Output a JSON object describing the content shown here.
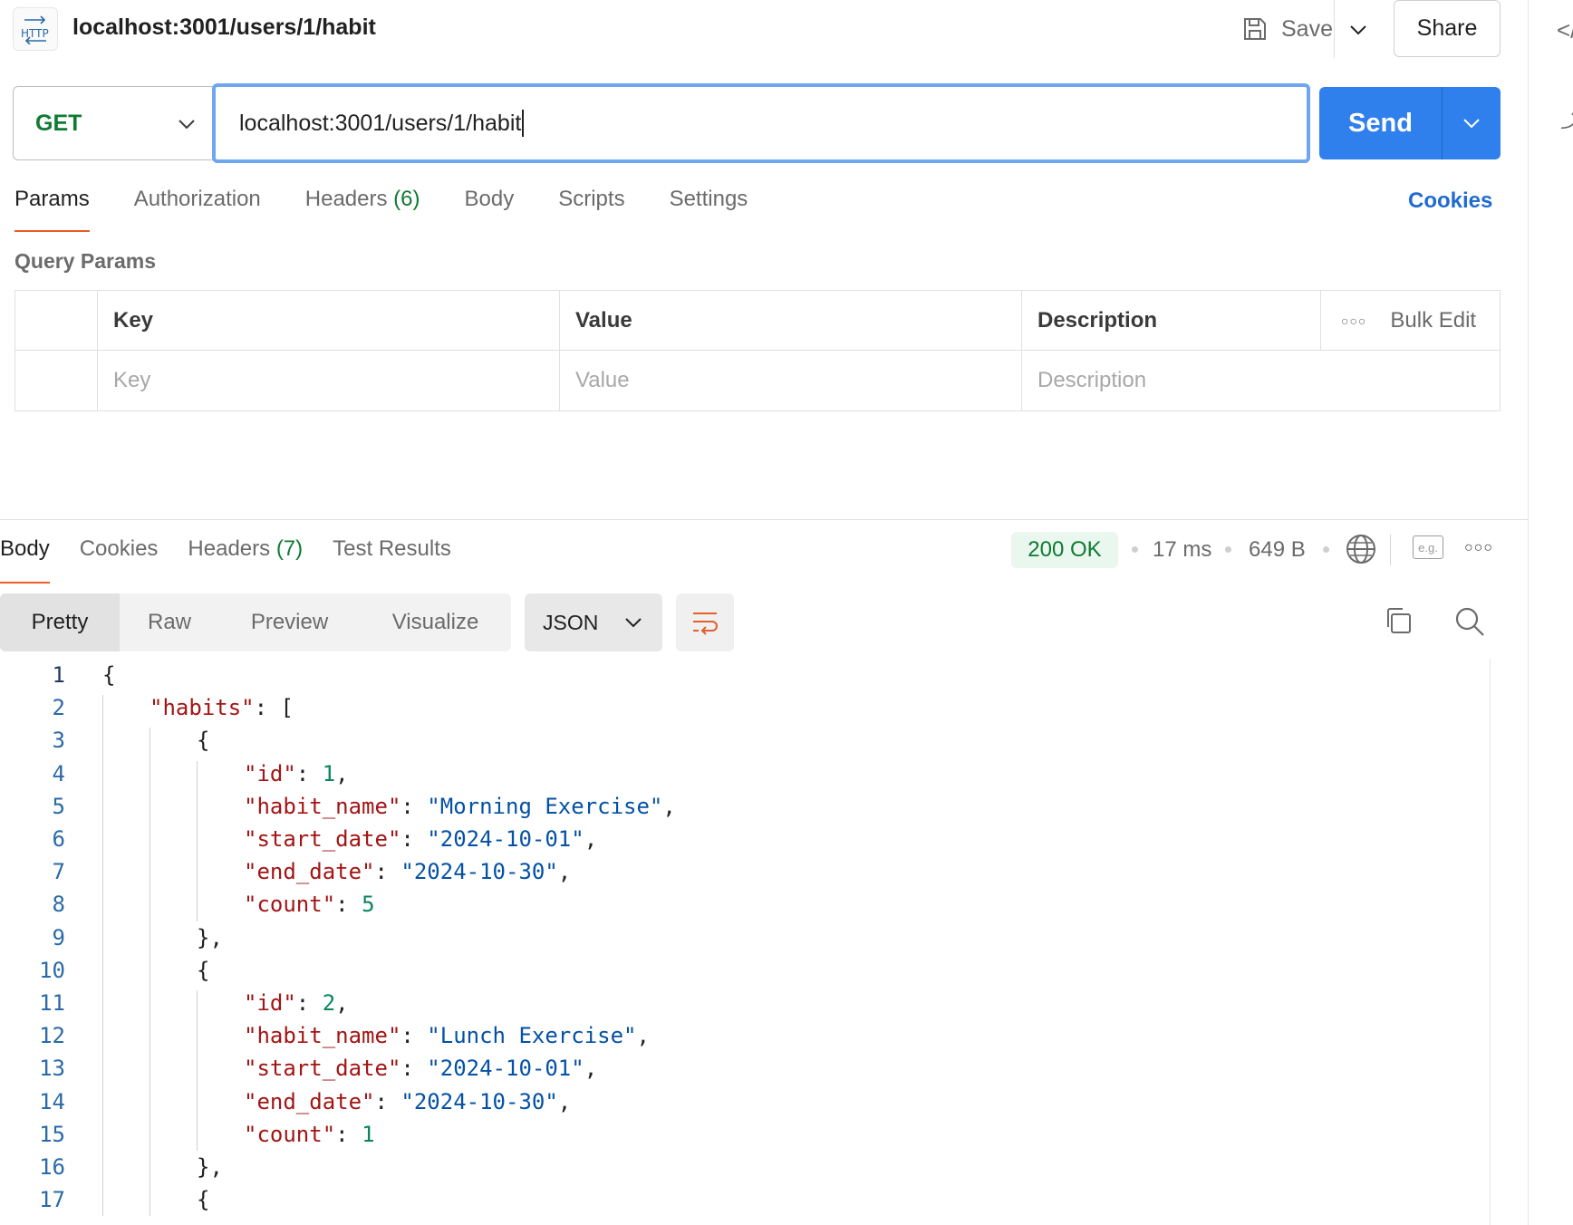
{
  "header": {
    "badge_label": "HTTP",
    "title": "localhost:3001/users/1/habit",
    "save_label": "Save",
    "share_label": "Share"
  },
  "request": {
    "method": "GET",
    "url": "localhost:3001/users/1/habit",
    "send_label": "Send"
  },
  "request_tabs": {
    "params": "Params",
    "authorization": "Authorization",
    "headers": "Headers",
    "headers_count": "(6)",
    "body": "Body",
    "scripts": "Scripts",
    "settings": "Settings",
    "cookies": "Cookies"
  },
  "query_params": {
    "title": "Query Params",
    "columns": {
      "key": "Key",
      "value": "Value",
      "description": "Description",
      "bulk_edit": "Bulk Edit"
    },
    "placeholders": {
      "key": "Key",
      "value": "Value",
      "description": "Description"
    }
  },
  "response_tabs": {
    "body": "Body",
    "cookies": "Cookies",
    "headers": "Headers",
    "headers_count": "(7)",
    "test_results": "Test Results"
  },
  "response_meta": {
    "status": "200 OK",
    "time": "17 ms",
    "size": "649 B",
    "example_label": "e.g."
  },
  "response_toolbar": {
    "views": [
      "Pretty",
      "Raw",
      "Preview",
      "Visualize"
    ],
    "active_view": "Pretty",
    "format": "JSON"
  },
  "code_lines": [
    {
      "n": "1",
      "indent": 0,
      "parts": [
        [
          "p",
          "{"
        ]
      ]
    },
    {
      "n": "2",
      "indent": 1,
      "parts": [
        [
          "k",
          "\"habits\""
        ],
        [
          "p",
          ": ["
        ]
      ]
    },
    {
      "n": "3",
      "indent": 2,
      "parts": [
        [
          "p",
          "{"
        ]
      ]
    },
    {
      "n": "4",
      "indent": 3,
      "parts": [
        [
          "k",
          "\"id\""
        ],
        [
          "p",
          ": "
        ],
        [
          "n",
          "1"
        ],
        [
          "p",
          ","
        ]
      ]
    },
    {
      "n": "5",
      "indent": 3,
      "parts": [
        [
          "k",
          "\"habit_name\""
        ],
        [
          "p",
          ": "
        ],
        [
          "s",
          "\"Morning Exercise\""
        ],
        [
          "p",
          ","
        ]
      ]
    },
    {
      "n": "6",
      "indent": 3,
      "parts": [
        [
          "k",
          "\"start_date\""
        ],
        [
          "p",
          ": "
        ],
        [
          "s",
          "\"2024-10-01\""
        ],
        [
          "p",
          ","
        ]
      ]
    },
    {
      "n": "7",
      "indent": 3,
      "parts": [
        [
          "k",
          "\"end_date\""
        ],
        [
          "p",
          ": "
        ],
        [
          "s",
          "\"2024-10-30\""
        ],
        [
          "p",
          ","
        ]
      ]
    },
    {
      "n": "8",
      "indent": 3,
      "parts": [
        [
          "k",
          "\"count\""
        ],
        [
          "p",
          ": "
        ],
        [
          "n",
          "5"
        ]
      ]
    },
    {
      "n": "9",
      "indent": 2,
      "parts": [
        [
          "p",
          "},"
        ]
      ]
    },
    {
      "n": "10",
      "indent": 2,
      "parts": [
        [
          "p",
          "{"
        ]
      ]
    },
    {
      "n": "11",
      "indent": 3,
      "parts": [
        [
          "k",
          "\"id\""
        ],
        [
          "p",
          ": "
        ],
        [
          "n",
          "2"
        ],
        [
          "p",
          ","
        ]
      ]
    },
    {
      "n": "12",
      "indent": 3,
      "parts": [
        [
          "k",
          "\"habit_name\""
        ],
        [
          "p",
          ": "
        ],
        [
          "s",
          "\"Lunch Exercise\""
        ],
        [
          "p",
          ","
        ]
      ]
    },
    {
      "n": "13",
      "indent": 3,
      "parts": [
        [
          "k",
          "\"start_date\""
        ],
        [
          "p",
          ": "
        ],
        [
          "s",
          "\"2024-10-01\""
        ],
        [
          "p",
          ","
        ]
      ]
    },
    {
      "n": "14",
      "indent": 3,
      "parts": [
        [
          "k",
          "\"end_date\""
        ],
        [
          "p",
          ": "
        ],
        [
          "s",
          "\"2024-10-30\""
        ],
        [
          "p",
          ","
        ]
      ]
    },
    {
      "n": "15",
      "indent": 3,
      "parts": [
        [
          "k",
          "\"count\""
        ],
        [
          "p",
          ": "
        ],
        [
          "n",
          "1"
        ]
      ]
    },
    {
      "n": "16",
      "indent": 2,
      "parts": [
        [
          "p",
          "},"
        ]
      ]
    },
    {
      "n": "17",
      "indent": 2,
      "parts": [
        [
          "p",
          "{"
        ]
      ]
    }
  ]
}
